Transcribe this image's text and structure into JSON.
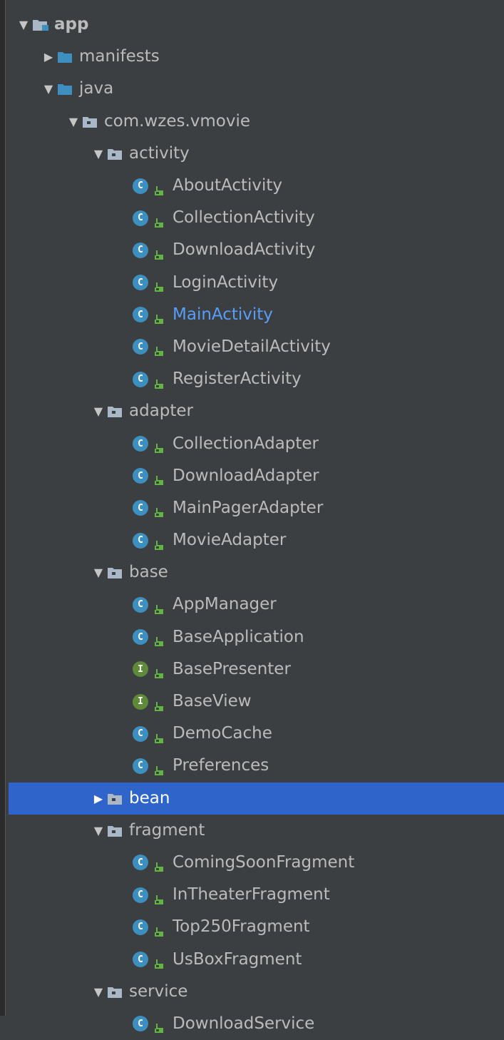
{
  "tree": {
    "rows": [
      {
        "label": "app",
        "level": 0,
        "kind": "module",
        "arrow": "expanded",
        "bold": true
      },
      {
        "label": "manifests",
        "level": 1,
        "kind": "source-folder",
        "arrow": "collapsed"
      },
      {
        "label": "java",
        "level": 1,
        "kind": "source-folder",
        "arrow": "expanded"
      },
      {
        "label": "com.wzes.vmovie",
        "level": 2,
        "kind": "package",
        "arrow": "expanded"
      },
      {
        "label": "activity",
        "level": 3,
        "kind": "package",
        "arrow": "expanded"
      },
      {
        "label": "AboutActivity",
        "level": 4,
        "kind": "class"
      },
      {
        "label": "CollectionActivity",
        "level": 4,
        "kind": "class"
      },
      {
        "label": "DownloadActivity",
        "level": 4,
        "kind": "class"
      },
      {
        "label": "LoginActivity",
        "level": 4,
        "kind": "class"
      },
      {
        "label": "MainActivity",
        "level": 4,
        "kind": "class",
        "active": true
      },
      {
        "label": "MovieDetailActivity",
        "level": 4,
        "kind": "class"
      },
      {
        "label": "RegisterActivity",
        "level": 4,
        "kind": "class"
      },
      {
        "label": "adapter",
        "level": 3,
        "kind": "package",
        "arrow": "expanded"
      },
      {
        "label": "CollectionAdapter",
        "level": 4,
        "kind": "class"
      },
      {
        "label": "DownloadAdapter",
        "level": 4,
        "kind": "class"
      },
      {
        "label": "MainPagerAdapter",
        "level": 4,
        "kind": "class"
      },
      {
        "label": "MovieAdapter",
        "level": 4,
        "kind": "class"
      },
      {
        "label": "base",
        "level": 3,
        "kind": "package",
        "arrow": "expanded"
      },
      {
        "label": "AppManager",
        "level": 4,
        "kind": "class"
      },
      {
        "label": "BaseApplication",
        "level": 4,
        "kind": "class"
      },
      {
        "label": "BasePresenter",
        "level": 4,
        "kind": "interface"
      },
      {
        "label": "BaseView",
        "level": 4,
        "kind": "interface"
      },
      {
        "label": "DemoCache",
        "level": 4,
        "kind": "class"
      },
      {
        "label": "Preferences",
        "level": 4,
        "kind": "class"
      },
      {
        "label": "bean",
        "level": 3,
        "kind": "package",
        "arrow": "collapsed",
        "selected": true
      },
      {
        "label": "fragment",
        "level": 3,
        "kind": "package",
        "arrow": "expanded"
      },
      {
        "label": "ComingSoonFragment",
        "level": 4,
        "kind": "class"
      },
      {
        "label": "InTheaterFragment",
        "level": 4,
        "kind": "class"
      },
      {
        "label": "Top250Fragment",
        "level": 4,
        "kind": "class"
      },
      {
        "label": "UsBoxFragment",
        "level": 4,
        "kind": "class"
      },
      {
        "label": "service",
        "level": 3,
        "kind": "package",
        "arrow": "expanded"
      },
      {
        "label": "DownloadService",
        "level": 4,
        "kind": "class"
      }
    ]
  },
  "icons": {
    "expanded": "▼",
    "collapsed": "▶",
    "class_letter": "C",
    "interface_letter": "I"
  },
  "colors": {
    "background": "#3c3f41",
    "selection": "#2f65ca",
    "text": "#bbbbbb",
    "active_text": "#589df6",
    "source_folder": "#3d8fbf",
    "package_folder": "#a9b7c6",
    "class_icon": "#3d8fbf",
    "interface_icon": "#5f8a3a",
    "visibility_icon": "#62b543"
  }
}
